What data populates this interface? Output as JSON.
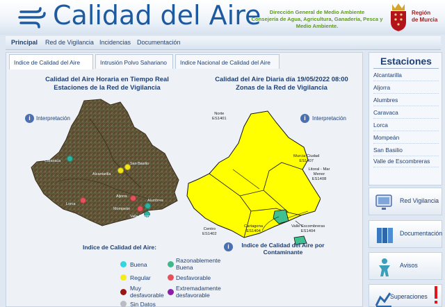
{
  "header": {
    "title": "Calidad del Aire",
    "dg_lines": [
      "Dirección General de Medio Ambiente",
      "Consejería de Agua, Agricultura, Ganadería, Pesca y",
      "Medio Ambiente."
    ],
    "region_lines": [
      "Región",
      "de Murcia"
    ]
  },
  "nav": {
    "items": [
      "Principal",
      "Red de Vigilancia",
      "Incidencias",
      "Documentación"
    ]
  },
  "tabs": [
    "Indice de Calidad del Aire",
    "Intrusión Polvo Sahariano",
    "Indice Nacional de Calidad del Aire"
  ],
  "left_panel": {
    "title_line1": "Calidad del Aire Horaria en Tiempo Real",
    "title_line2": "Estaciones de la Red de Vigilancia",
    "interp": "Interpretación",
    "stations": [
      {
        "name": "Caravaca",
        "color": "#2bb3a0"
      },
      {
        "name": "San Basilio",
        "color": "#f2e31a"
      },
      {
        "name": "Alcantarilla",
        "color": "#f2e31a"
      },
      {
        "name": "Lorca",
        "color": "#e8505b"
      },
      {
        "name": "Aljorra",
        "color": "#e8505b"
      },
      {
        "name": "Alumbres",
        "color": "#2bb3a0"
      },
      {
        "name": "Mompeán",
        "color": "#e8505b"
      },
      {
        "name": "Valle Escombreras",
        "color": "#2bb3a0"
      }
    ]
  },
  "right_panel": {
    "title_line1": "Calidad del Aire Diaria día 19/05/2022 08:00",
    "title_line2": "Zonas de la Red de Vigilancia",
    "interp": "Interpretación",
    "zones": [
      {
        "name": "Norte",
        "code": "ES1401"
      },
      {
        "name": "Murcia Ciudad",
        "code": "ES1407"
      },
      {
        "name": "Litoral - Mar Menor",
        "code": "ES1408"
      },
      {
        "name": "Cartagena",
        "code": "ES1404"
      },
      {
        "name": "Valle Escombreras",
        "code": "ES1404"
      },
      {
        "name": "Centro",
        "code": "ES1402"
      }
    ],
    "contaminant_link": "Indice de Calidad del Aire por Contaminante"
  },
  "legend": {
    "title": "Indice de Calidad del Aire:",
    "items": [
      {
        "label": "Buena",
        "color": "#33d6e0"
      },
      {
        "label": "Razonablemente Buena",
        "color": "#3fb98a"
      },
      {
        "label": "Regular",
        "color": "#f4ea1c"
      },
      {
        "label": "Desfavorable",
        "color": "#e8505b"
      },
      {
        "label": "Muy desfavorable",
        "color": "#9b1515"
      },
      {
        "label": "Extremadamente desfavorable",
        "color": "#8b1ea8"
      },
      {
        "label": "Sin Datos",
        "color": "#b9bcc2"
      }
    ]
  },
  "sidebar": {
    "title": "Estaciones",
    "items": [
      "Alcantarilla",
      "Aljorra",
      "Alumbres",
      "Caravaca",
      "Lorca",
      "Mompeán",
      "San Basilio",
      "Valle de Escombreras"
    ]
  },
  "side_buttons": [
    "Red Vigilancia",
    "Documentación",
    "Avisos",
    "Superaciones"
  ]
}
